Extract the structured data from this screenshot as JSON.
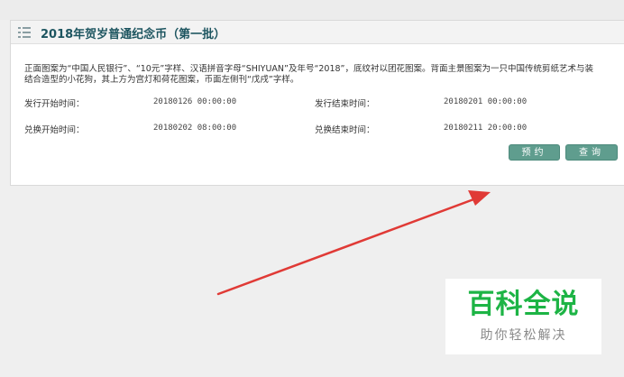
{
  "panel": {
    "title": "2018年贺岁普通纪念币（第一批）",
    "description_line1": "正面图案为“中国人民银行”、“10元”字样、汉语拼音字母“SHIYUAN”及年号“2018”，底纹衬以团花图案。背面主景图案为一只中国传统剪纸艺术与装",
    "description_line2": "结合造型的小花狗，其上方为宫灯和荷花图案，币面左侧刊“戊戌”字样。"
  },
  "fields": {
    "issue_start_label": "发行开始时间：",
    "issue_start_value": "20180126 00:00:00",
    "issue_end_label": "发行结束时间：",
    "issue_end_value": "20180201 00:00:00",
    "exchange_start_label": "兑换开始时间：",
    "exchange_start_value": "20180202 08:00:00",
    "exchange_end_label": "兑换结束时间：",
    "exchange_end_value": "20180211 20:00:00"
  },
  "buttons": {
    "reserve_label": "预约",
    "query_label": "查询"
  },
  "watermark": {
    "title": "百科全说",
    "subtitle": "助你轻松解决"
  },
  "colors": {
    "title_text": "#1d5560",
    "button_bg": "#5f9d8e",
    "arrow": "#e03a36",
    "watermark_green": "#1db445"
  },
  "icons": [
    "list-icon",
    "annotation-arrow"
  ]
}
